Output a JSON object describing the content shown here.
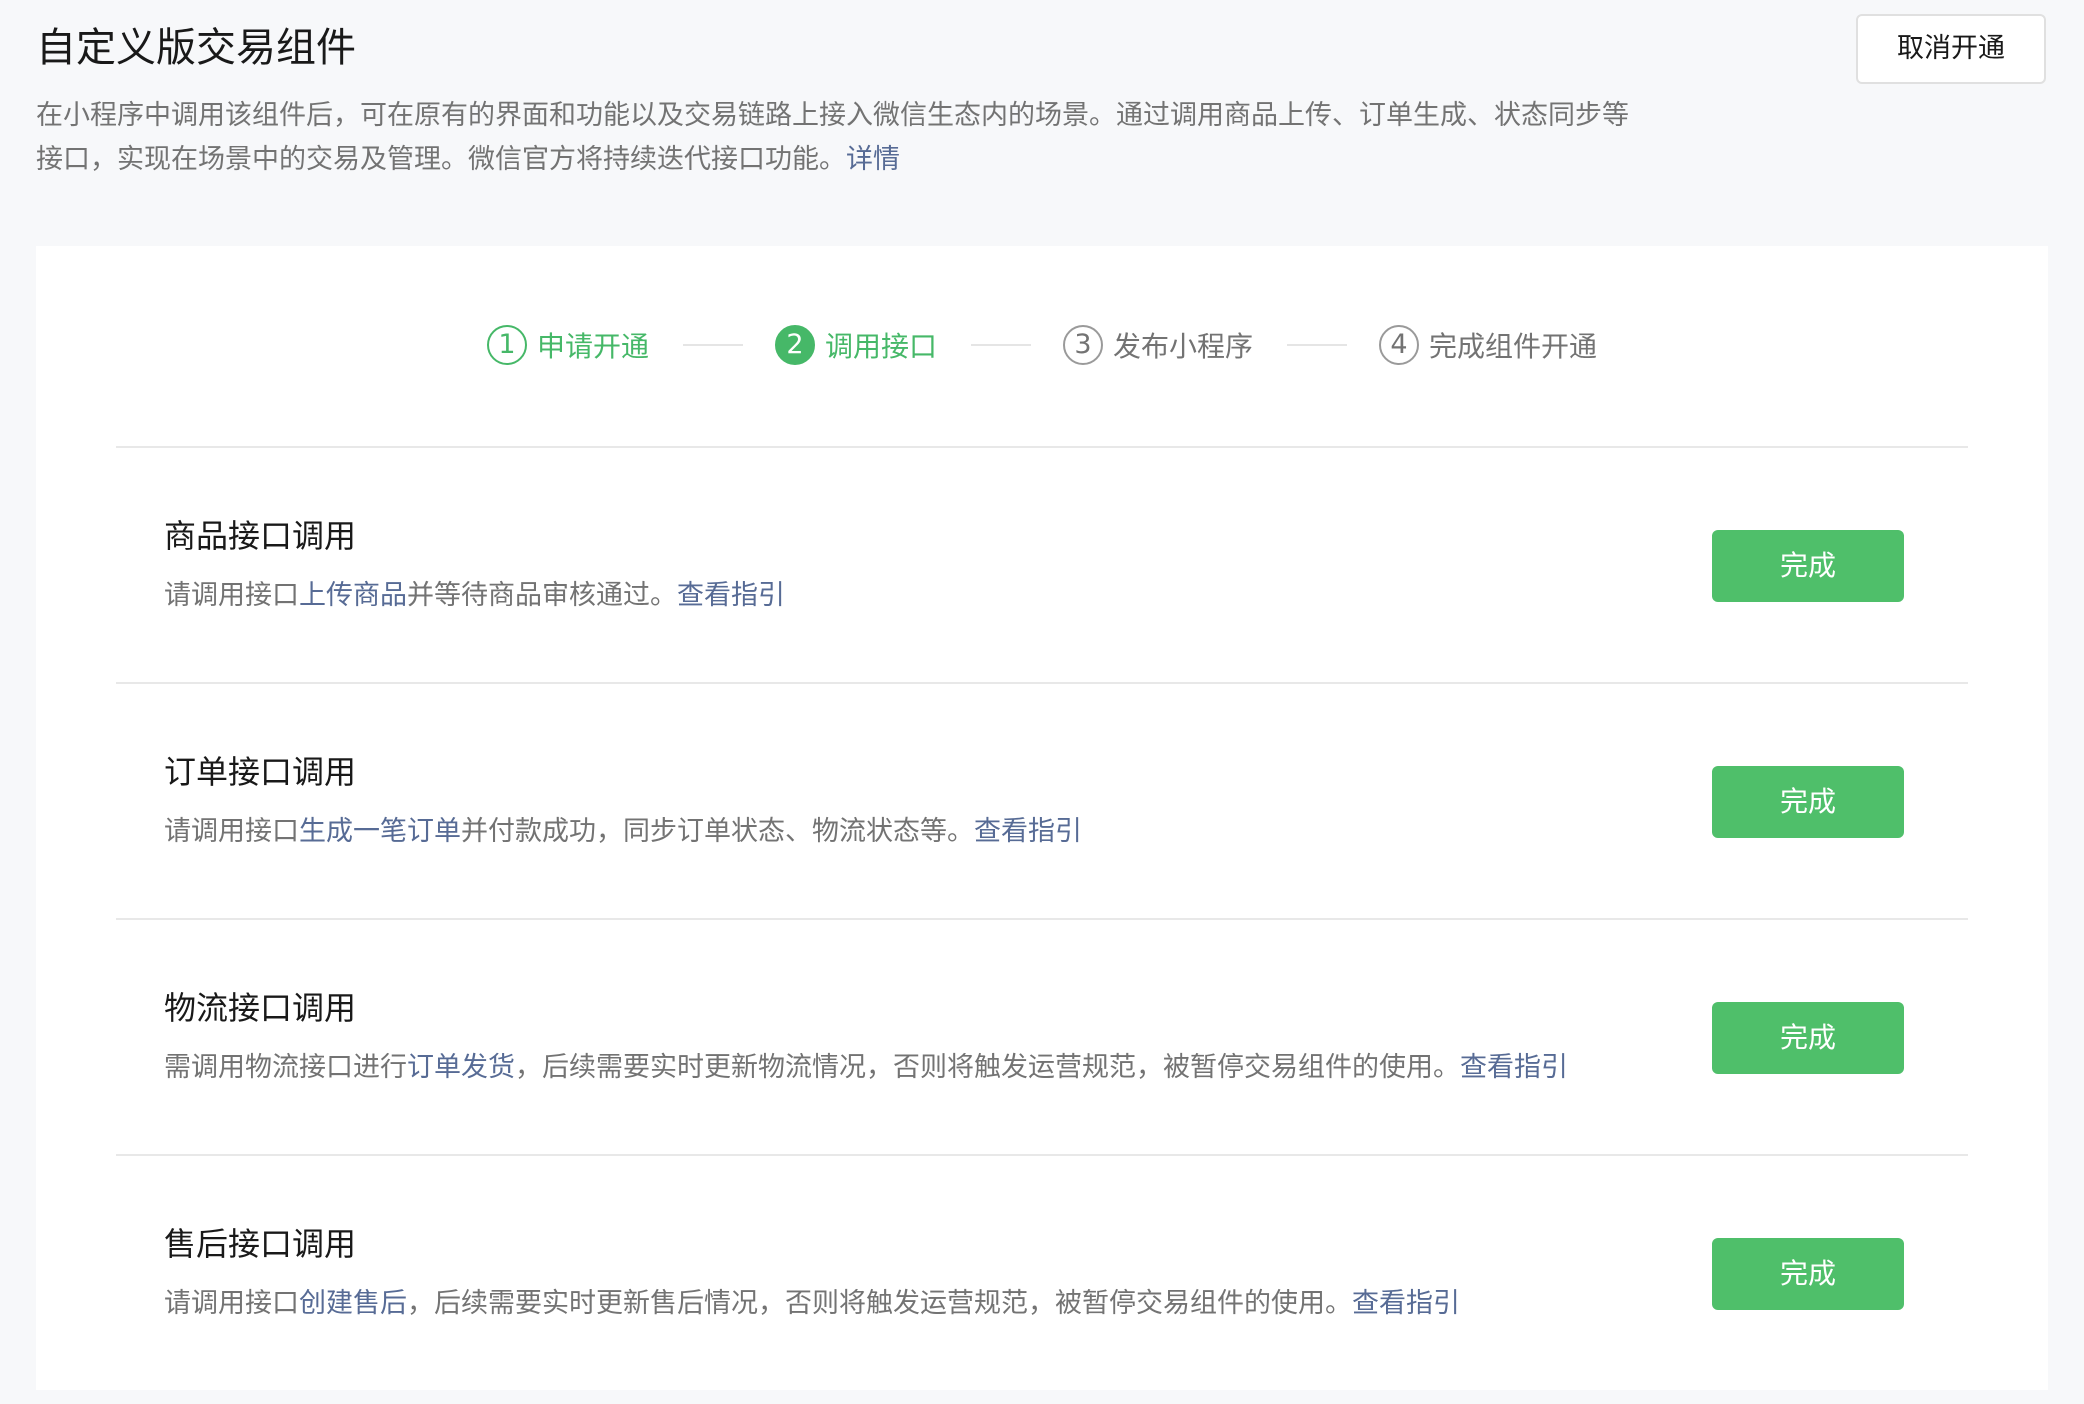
{
  "header": {
    "title": "自定义版交易组件",
    "cancel_label": "取消开通",
    "desc_line1": "在小程序中调用该组件后，可在原有的界面和功能以及交易链路上接入微信生态内的场景。通过调用商品上传、订单生成、状态同步等",
    "desc_line2": "接口，实现在场景中的交易及管理。微信官方将持续迭代接口功能。",
    "desc_link": "详情"
  },
  "steps": [
    {
      "num": "1",
      "label": "申请开通",
      "status": "done"
    },
    {
      "num": "2",
      "label": "调用接口",
      "status": "current"
    },
    {
      "num": "3",
      "label": "发布小程序",
      "status": "pending"
    },
    {
      "num": "4",
      "label": "完成组件开通",
      "status": "pending"
    }
  ],
  "sections": [
    {
      "title": "商品接口调用",
      "desc_before": "请调用接口",
      "desc_link": "上传商品",
      "desc_after": "并等待商品审核通过。",
      "guide_link": "查看指引",
      "button": "完成"
    },
    {
      "title": "订单接口调用",
      "desc_before": "请调用接口",
      "desc_link": "生成一笔订单",
      "desc_after": "并付款成功，同步订单状态、物流状态等。",
      "guide_link": "查看指引",
      "button": "完成"
    },
    {
      "title": "物流接口调用",
      "desc_before": "需调用物流接口进行",
      "desc_link": "订单发货",
      "desc_after": "，后续需要实时更新物流情况，否则将触发运营规范，被暂停交易组件的使用。",
      "guide_link": "查看指引",
      "button": "完成"
    },
    {
      "title": "售后接口调用",
      "desc_before": "请调用接口",
      "desc_link": "创建售后",
      "desc_after": "，后续需要实时更新售后情况，否则将触发运营规范，被暂停交易组件的使用。",
      "guide_link": "查看指引",
      "button": "完成"
    }
  ],
  "colors": {
    "accent_green": "#4fbf6a",
    "link_blue": "#576b95",
    "text_secondary": "#737373"
  }
}
